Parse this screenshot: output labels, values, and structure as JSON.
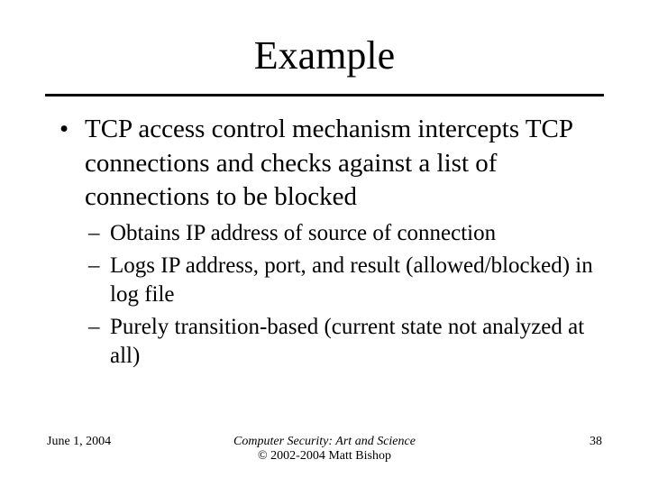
{
  "title": "Example",
  "bullets": {
    "main": "TCP access control mechanism intercepts TCP connections and checks against a list of connections to be blocked",
    "subs": [
      "Obtains IP address of source of connection",
      "Logs IP address, port, and result (allowed/blocked) in log file",
      "Purely transition-based (current state not analyzed at all)"
    ]
  },
  "footer": {
    "date": "June 1, 2004",
    "center_line1": "Computer Security: Art and Science",
    "center_line2": "© 2002-2004 Matt Bishop",
    "page": "38"
  }
}
